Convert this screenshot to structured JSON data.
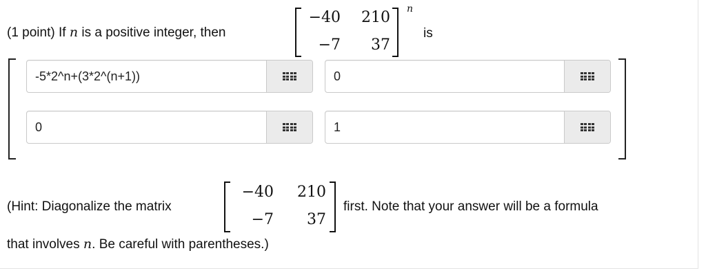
{
  "question": {
    "prefix": "(1 point) If",
    "var_n": "n",
    "middle": "is a positive integer, then",
    "matrix": {
      "r1c1": "−40",
      "r1c2": "210",
      "r2c1": "−7",
      "r2c2": "37"
    },
    "exponent": "n",
    "suffix": "is"
  },
  "answer": {
    "cells": [
      {
        "value": "-5*2^n+(3*2^(n+1))"
      },
      {
        "value": "0"
      },
      {
        "value": "0"
      },
      {
        "value": "1"
      }
    ],
    "keyboard_icon": "grid-keypad-icon"
  },
  "hint": {
    "part1": "(Hint: Diagonalize the matrix",
    "matrix": {
      "r1c1": "−40",
      "r1c2": "210",
      "r2c1": "−7",
      "r2c2": "37"
    },
    "part2": "first. Note that your answer will be a formula",
    "part3_a": "that involves",
    "var_n": "n",
    "part3_b": ". Be careful with parentheses.)"
  }
}
